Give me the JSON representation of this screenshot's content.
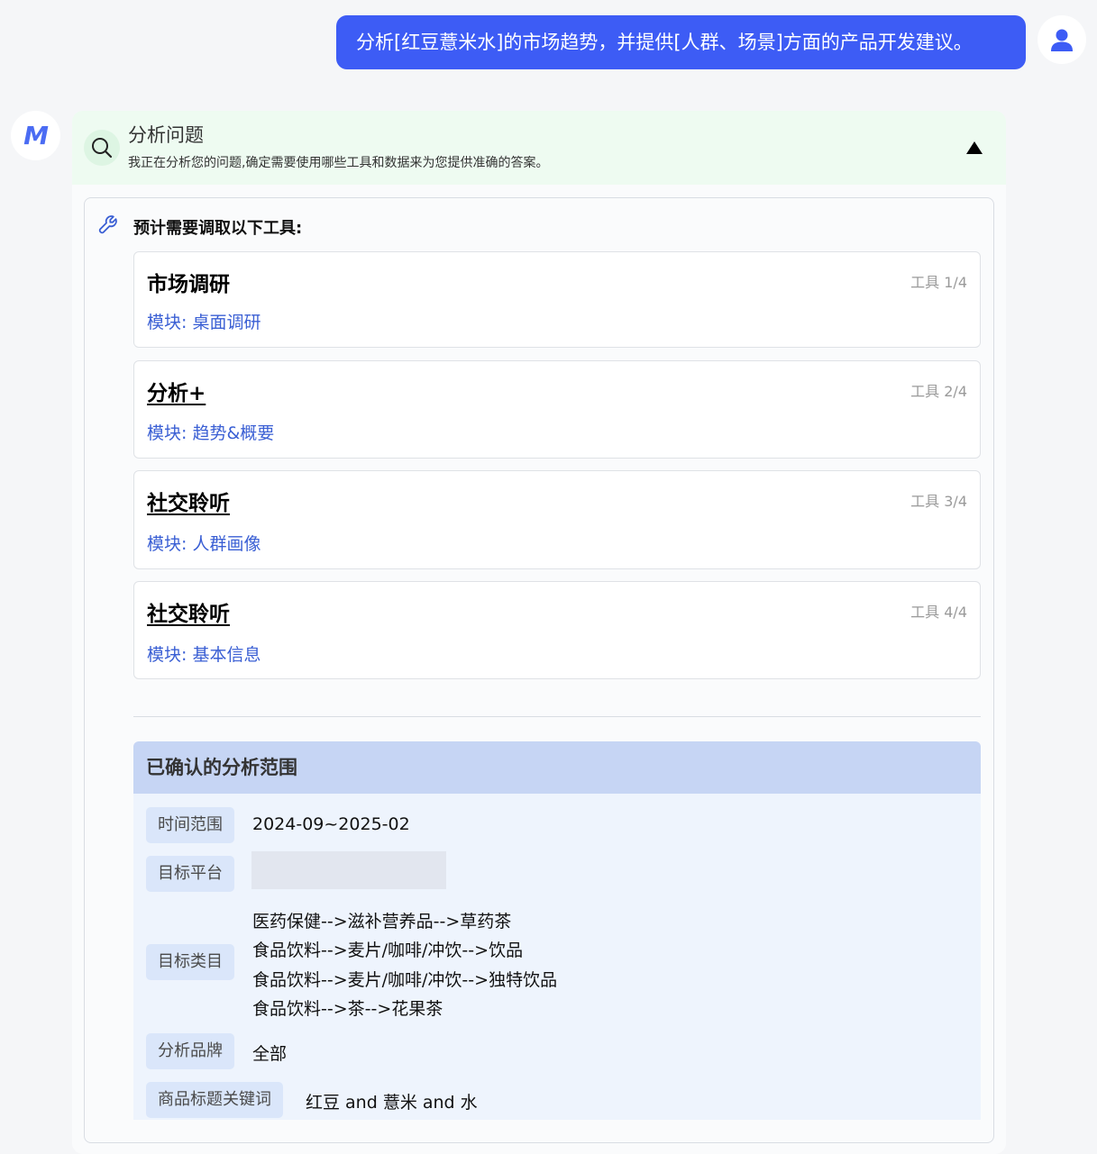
{
  "user_message": {
    "text": "分析[红豆薏米水]的市场趋势，并提供[人群、场景]方面的产品开发建议。",
    "avatar_icon": "user-icon"
  },
  "bot": {
    "logo_text": "M"
  },
  "panel": {
    "title": "分析问题",
    "subtitle": "我正在分析您的问题,确定需要使用哪些工具和数据来为您提供准确的答案。",
    "header_bg": "#eefbf1",
    "tools_heading": "预计需要调取以下工具:",
    "tools": [
      {
        "name": "市场调研",
        "index": "工具 1/4",
        "module": "模块: 桌面调研"
      },
      {
        "name": "分析+",
        "index": "工具 2/4",
        "module": "模块: 趋势&概要"
      },
      {
        "name": "社交聆听",
        "index": "工具 3/4",
        "module": "模块: 人群画像"
      },
      {
        "name": "社交聆听",
        "index": "工具 4/4",
        "module": "模块: 基本信息"
      }
    ],
    "scope": {
      "title": "已确认的分析范围",
      "time_label": "时间范围",
      "time_value": "2024-09~2025-02",
      "platform_label": "目标平台",
      "category_label": "目标类目",
      "categories": [
        "医药保健-->滋补营养品-->草药茶",
        "食品饮料-->麦片/咖啡/冲饮-->饮品",
        "食品饮料-->麦片/咖啡/冲饮-->独特饮品",
        "食品饮料-->茶-->花果茶"
      ],
      "brand_label": "分析品牌",
      "brand_value": "全部",
      "keyword_label": "商品标题关键词",
      "keyword_value": "红豆 and 薏米 and 水"
    }
  },
  "colors": {
    "accent": "#3d5cf5",
    "module_text": "#3a5fd4",
    "scope_header": "#c6d5f4"
  }
}
